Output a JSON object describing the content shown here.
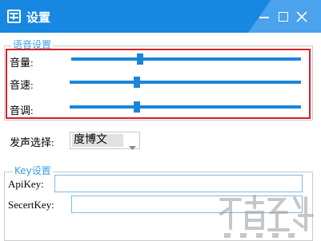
{
  "window": {
    "title": "设置",
    "title_bar_color": "#1787e1",
    "controls": [
      "minimize-icon",
      "maximize-icon",
      "close-icon"
    ]
  },
  "voice_settings": {
    "group_label": "语音设置",
    "highlight_color": "#d61f2a",
    "volume": {
      "label": "音量:",
      "level": 0.3
    },
    "speed": {
      "label": "音速:",
      "level": 0.29
    },
    "pitch": {
      "label": "音调:",
      "level": 0.29
    }
  },
  "speaker": {
    "label": "发声选择:",
    "selected": "度博文"
  },
  "key_settings": {
    "group_label": "Key设置",
    "api_key": {
      "label": "ApiKey:",
      "value": ""
    },
    "secret_key": {
      "label": "SecertKey:",
      "value": ""
    }
  },
  "accent_color": "#1b86d9"
}
